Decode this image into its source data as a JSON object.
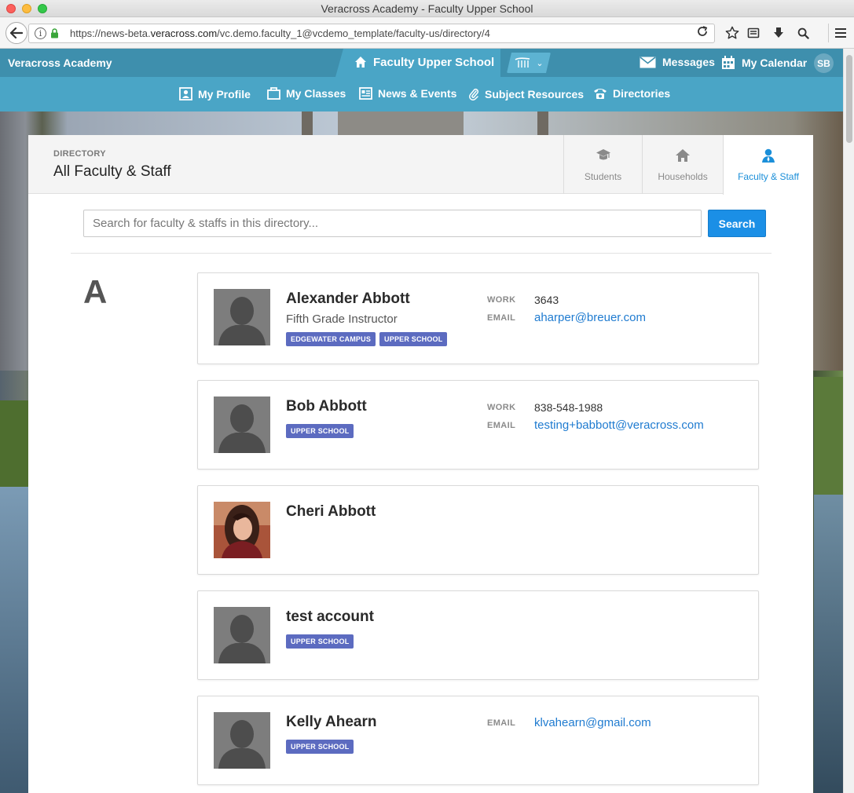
{
  "browser": {
    "window_title": "Veracross Academy - Faculty Upper School",
    "url_prefix": "https://news-beta.",
    "url_domain": "veracross.com",
    "url_path": "/vc.demo.faculty_1@vcdemo_template/faculty-us/directory/4"
  },
  "header": {
    "brand": "Veracross Academy",
    "portal": "Faculty Upper School",
    "messages": "Messages",
    "calendar": "My Calendar",
    "user_initials": "SB"
  },
  "nav": {
    "items": [
      {
        "label": "My Profile",
        "icon": "profile-icon"
      },
      {
        "label": "My Classes",
        "icon": "classes-icon"
      },
      {
        "label": "News & Events",
        "icon": "news-icon"
      },
      {
        "label": "Subject Resources",
        "icon": "paperclip-icon"
      },
      {
        "label": "Directories",
        "icon": "phone-icon"
      }
    ]
  },
  "directory": {
    "section_label": "DIRECTORY",
    "title": "All Faculty & Staff",
    "tabs": [
      {
        "label": "Students",
        "icon": "graduation-cap-icon",
        "active": false
      },
      {
        "label": "Households",
        "icon": "house-icon",
        "active": false
      },
      {
        "label": "Faculty & Staff",
        "icon": "person-icon",
        "active": true
      }
    ],
    "search_placeholder": "Search for faculty & staffs in this directory...",
    "search_button": "Search",
    "letter": "A"
  },
  "people": [
    {
      "name": "Alexander Abbott",
      "title": "Fifth Grade Instructor",
      "badges": [
        "EDGEWATER CAMPUS",
        "UPPER SCHOOL"
      ],
      "work_label": "WORK",
      "work": "3643",
      "email_label": "EMAIL",
      "email": "aharper@breuer.com",
      "photo": "silhouette"
    },
    {
      "name": "Bob Abbott",
      "badges": [
        "UPPER SCHOOL"
      ],
      "work_label": "WORK",
      "work": "838-548-1988",
      "email_label": "EMAIL",
      "email": "testing+babbott@veracross.com",
      "photo": "silhouette"
    },
    {
      "name": "Cheri Abbott",
      "photo": "portrait"
    },
    {
      "name": "test account",
      "badges": [
        "UPPER SCHOOL"
      ],
      "photo": "silhouette"
    },
    {
      "name": "Kelly Ahearn",
      "badges": [
        "UPPER SCHOOL"
      ],
      "email_label": "EMAIL",
      "email": "klvahearn@gmail.com",
      "photo": "silhouette"
    }
  ],
  "colors": {
    "header": "#3e8fad",
    "nav": "#4aa5c6",
    "accent": "#1b8fe6",
    "badge": "#5c6bc0",
    "link": "#1f7bd0"
  }
}
